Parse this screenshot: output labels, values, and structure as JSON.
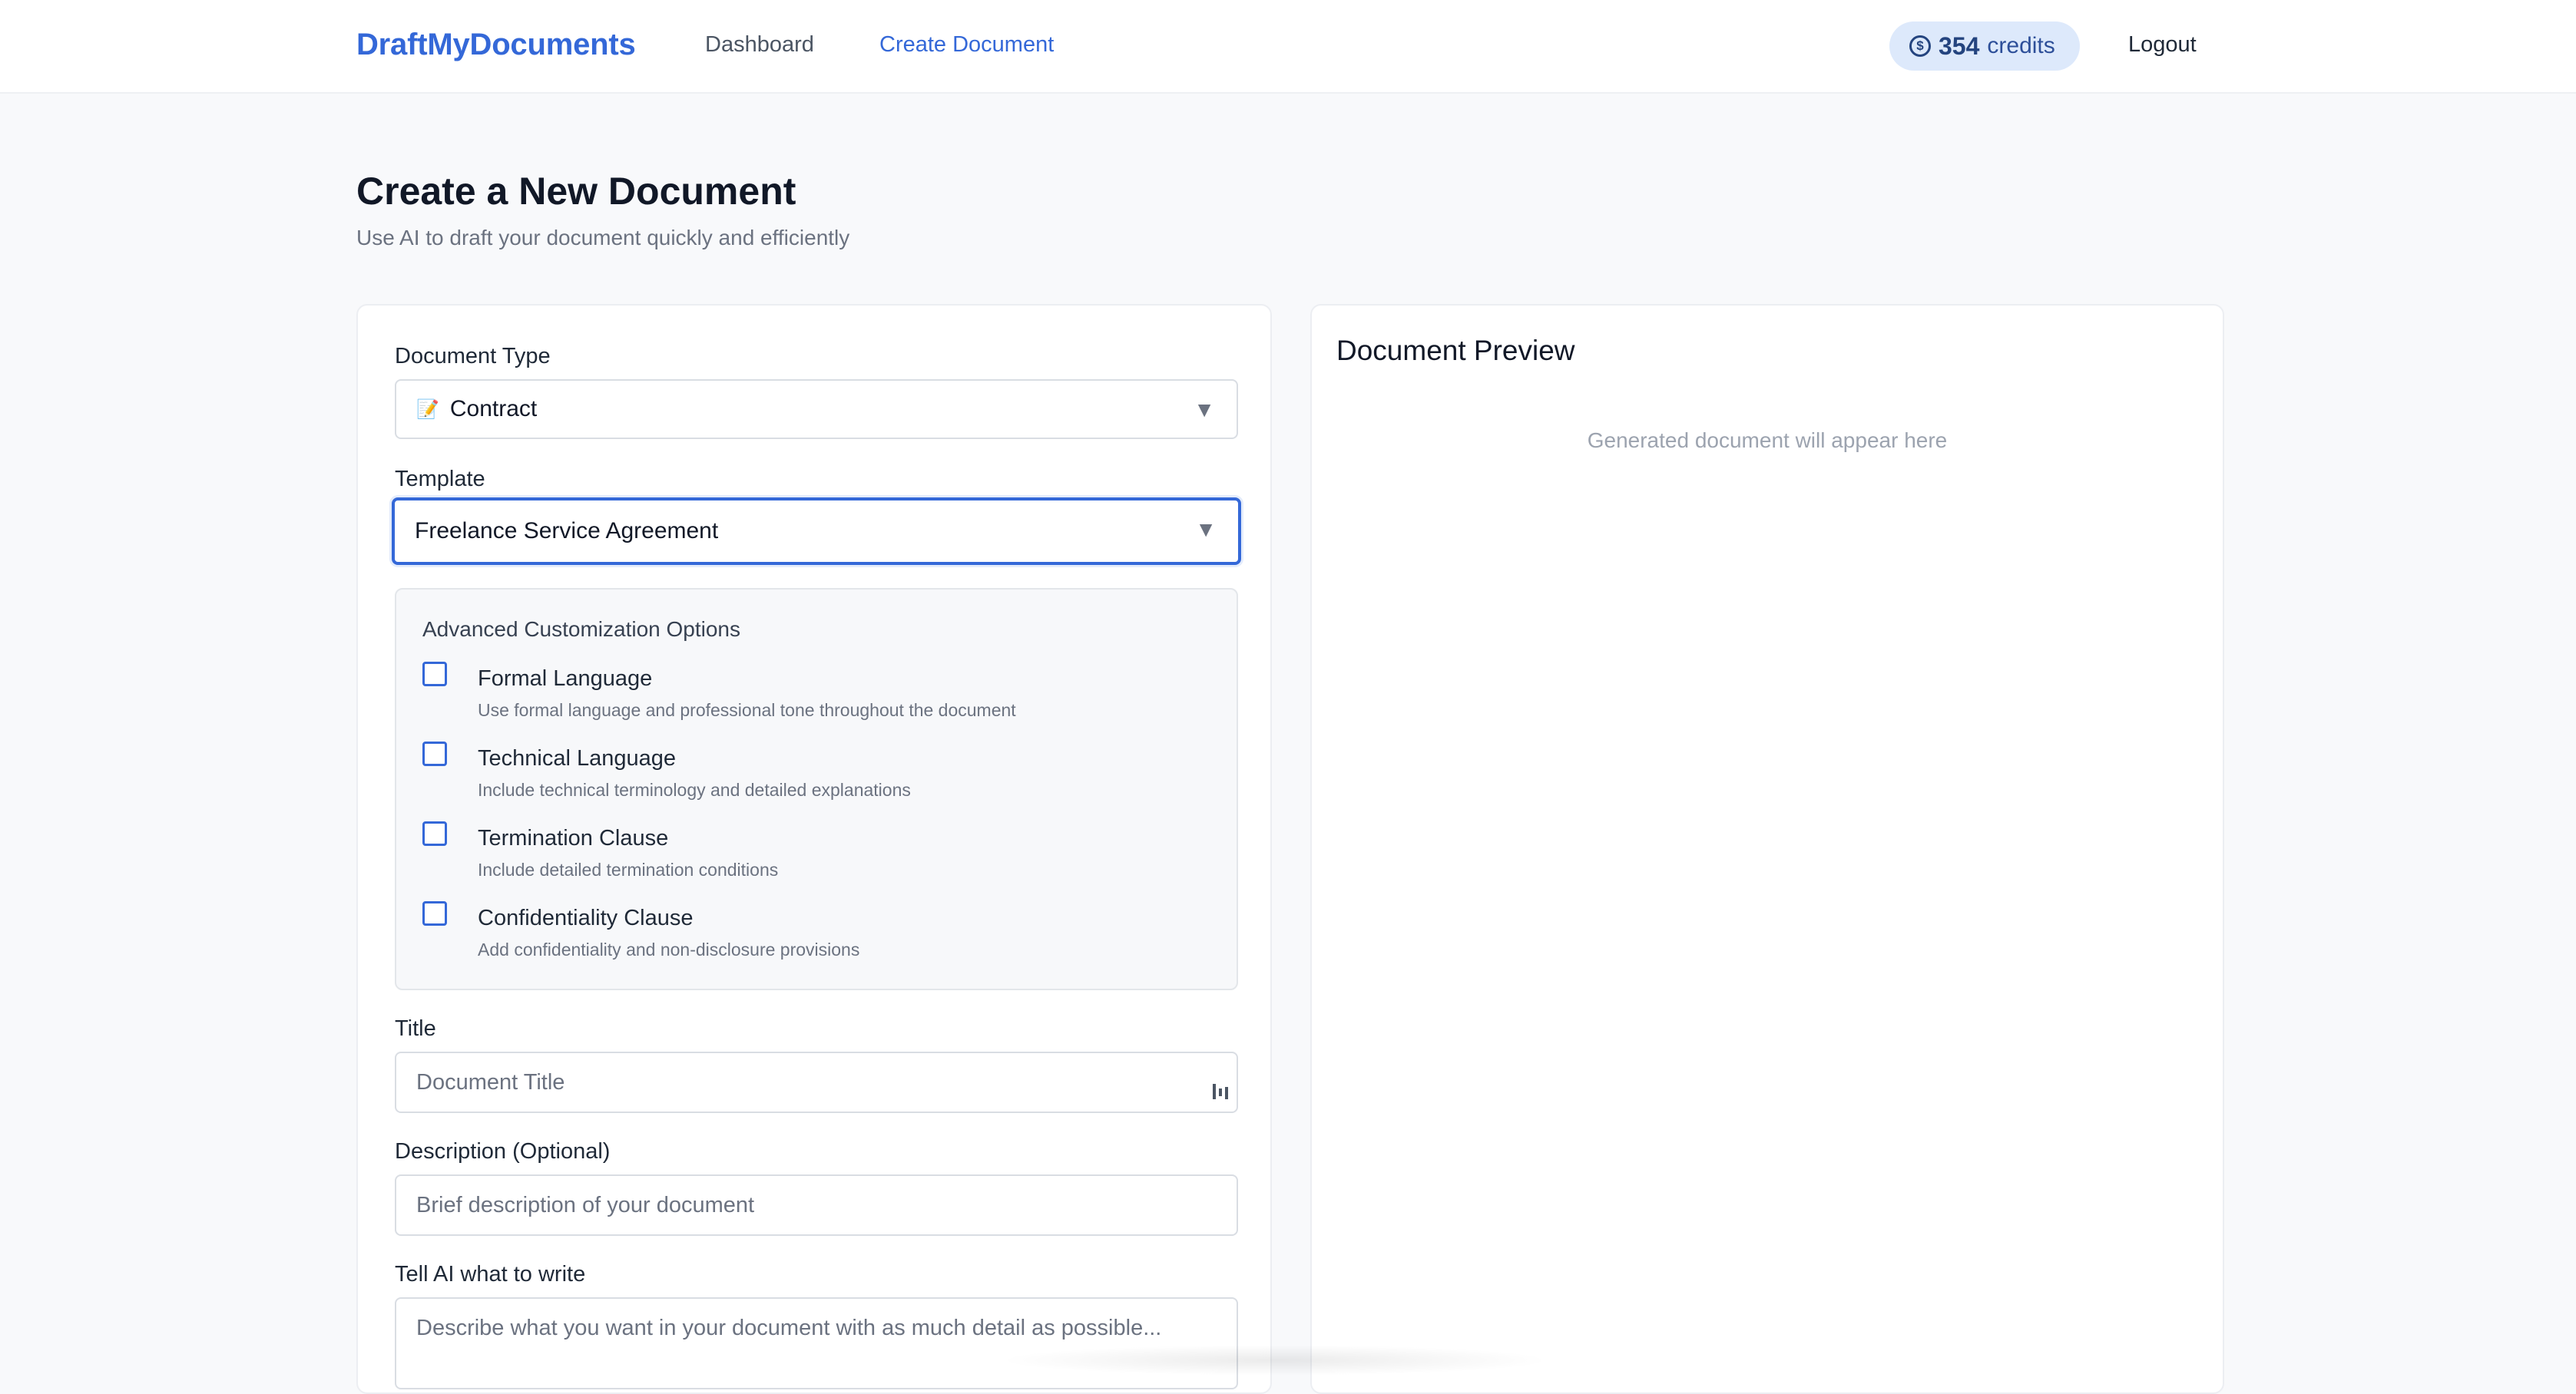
{
  "nav": {
    "brand": "DraftMyDocuments",
    "links": [
      "Dashboard",
      "Create Document"
    ],
    "credits_value": "354",
    "credits_label": "credits",
    "logout": "Logout"
  },
  "header": {
    "title": "Create a New Document",
    "subtitle": "Use AI to draft your document quickly and efficiently"
  },
  "form": {
    "document_type_label": "Document Type",
    "document_type_value": "Contract",
    "document_type_icon": "memo-icon",
    "template_label": "Template",
    "template_value": "Freelance Service Agreement",
    "advanced_title": "Advanced Customization Options",
    "options": [
      {
        "label": "Formal Language",
        "desc": "Use formal language and professional tone throughout the document",
        "checked": false
      },
      {
        "label": "Technical Language",
        "desc": "Include technical terminology and detailed explanations",
        "checked": false
      },
      {
        "label": "Termination Clause",
        "desc": "Include detailed termination conditions",
        "checked": false
      },
      {
        "label": "Confidentiality Clause",
        "desc": "Add confidentiality and non-disclosure provisions",
        "checked": false
      }
    ],
    "title_label": "Title",
    "title_placeholder": "Document Title",
    "description_label": "Description (Optional)",
    "description_placeholder": "Brief description of your document",
    "prompt_label": "Tell AI what to write",
    "prompt_placeholder": "Describe what you want in your document with as much detail as possible..."
  },
  "preview": {
    "title": "Document Preview",
    "empty_text": "Generated document will appear here"
  },
  "colors": {
    "accent": "#3468d8",
    "credits_bg": "#dde9fb",
    "page_bg": "#f8f9fb"
  }
}
